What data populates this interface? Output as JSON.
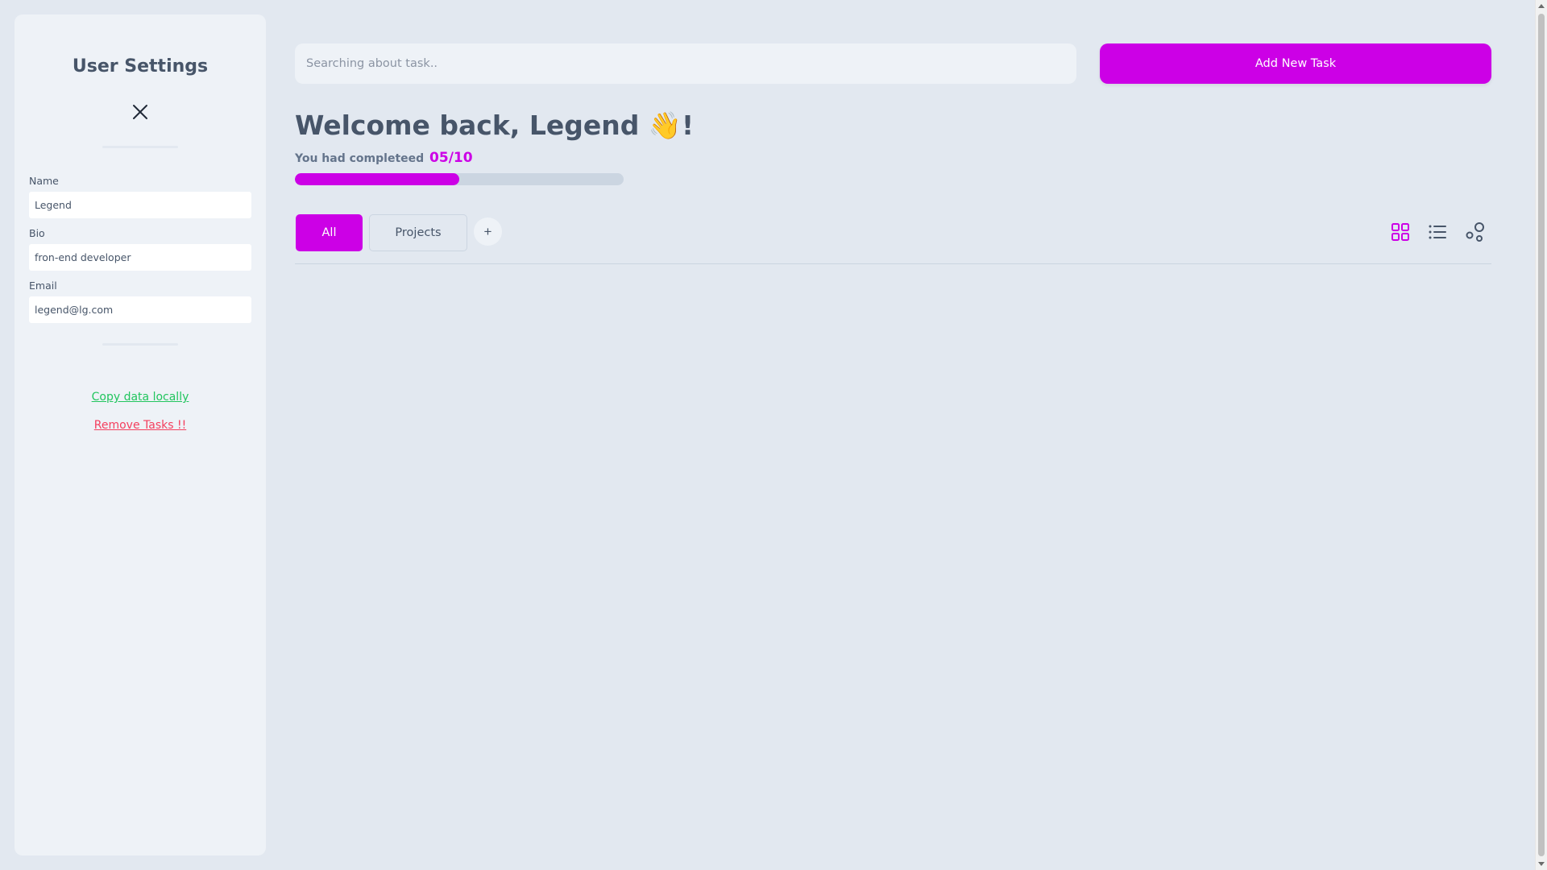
{
  "sidebar": {
    "title": "User Settings",
    "fields": {
      "name": {
        "label": "Name",
        "value": "Legend"
      },
      "bio": {
        "label": "Bio",
        "value": "fron-end developer"
      },
      "email": {
        "label": "Email",
        "value": "legend@lg.com"
      }
    },
    "copy_link": "Copy data locally",
    "remove_link": "Remove Tasks !!"
  },
  "header": {
    "search_placeholder": "Searching about task..",
    "add_button": "Add New Task"
  },
  "welcome": {
    "greeting": "Welcome back, Legend ",
    "wave": "👋",
    "exclaim": "!",
    "completed_label": "You had completeed",
    "completed_count": "05/10",
    "progress_fraction": 0.5
  },
  "tabs": {
    "all": "All",
    "projects": "Projects",
    "add": "+"
  },
  "icons": {
    "close": "close-icon",
    "grid_view": "grid-view-icon",
    "list_view": "list-view-icon",
    "theme": "theme-shapes-icon"
  },
  "colors": {
    "accent": "#cc00e6",
    "success": "#22c55e",
    "danger": "#f43f5e",
    "background": "#e2e8f0",
    "panel": "#eef2f7",
    "text": "#475569"
  }
}
